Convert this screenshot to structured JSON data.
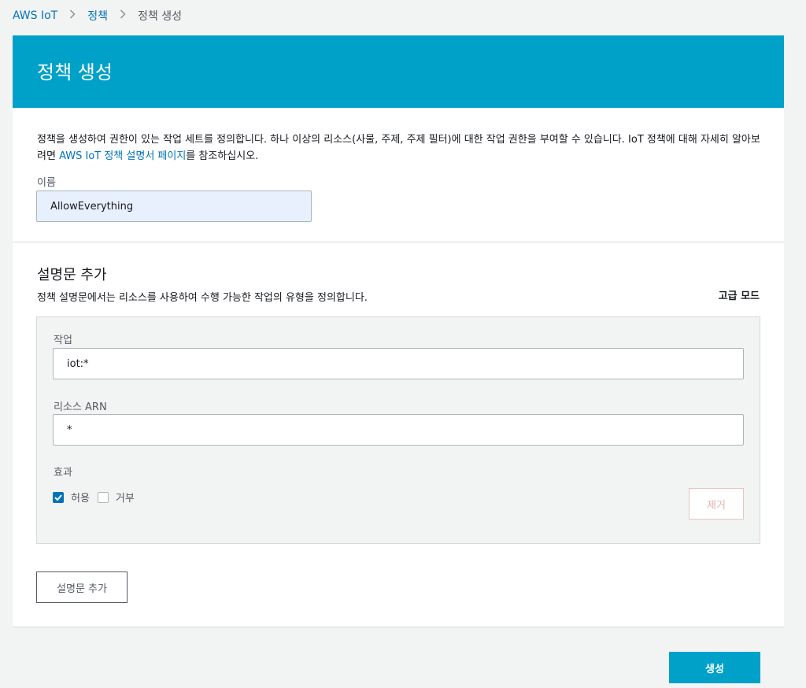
{
  "breadcrumb": {
    "items": [
      "AWS IoT",
      "정책",
      "정책 생성"
    ],
    "separator_icon": "chevron-right-icon"
  },
  "header": {
    "title": "정책 생성",
    "color": "#00a1c9"
  },
  "intro": {
    "text_before": "정책을 생성하여 권한이 있는 작업 세트를 정의합니다. 하나 이상의 리소스(사물, 주제, 주제 필터)에 대한 작업 권한을 부여할 수 있습니다. IoT 정책에 대해 자세히 알아보려면 ",
    "link": "AWS IoT 정책 설명서 페이지",
    "text_after": "를 참조하십시오."
  },
  "name_field": {
    "label": "이름",
    "value": "AllowEverything"
  },
  "statements_section": {
    "title": "설명문 추가",
    "description": "정책 설명문에서는 리소스를 사용하여 수행 가능한 작업의 유형을 정의합니다.",
    "advanced_mode": "고급 모드"
  },
  "statement": {
    "action_label": "작업",
    "action_value": "iot:*",
    "resource_label": "리소스 ARN",
    "resource_value": "*",
    "effect_label": "효과",
    "allow_label": "허용",
    "allow_checked": true,
    "deny_label": "거부",
    "deny_checked": false,
    "remove_label": "제거"
  },
  "add_statement_button": "설명문 추가",
  "create_button": "생성"
}
